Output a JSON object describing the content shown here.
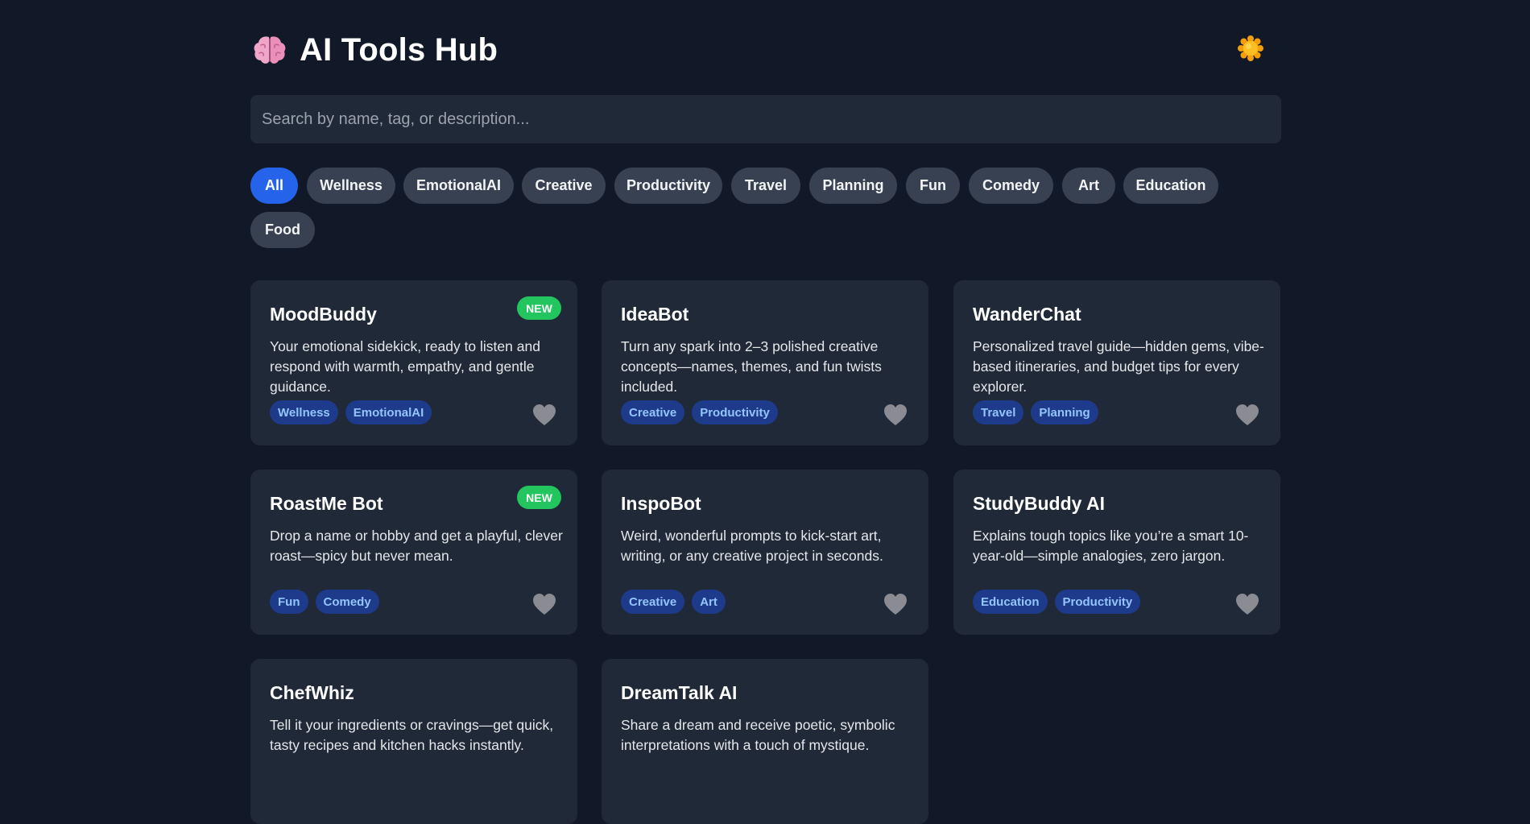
{
  "header": {
    "logo_icon": "brain-icon",
    "title": "AI Tools Hub",
    "theme_toggle_icon": "sun-icon"
  },
  "search": {
    "placeholder": "Search by name, tag, or description...",
    "value": ""
  },
  "filters": [
    {
      "label": "All",
      "active": true
    },
    {
      "label": "Wellness"
    },
    {
      "label": "EmotionalAI"
    },
    {
      "label": "Creative"
    },
    {
      "label": "Productivity"
    },
    {
      "label": "Travel"
    },
    {
      "label": "Planning"
    },
    {
      "label": "Fun"
    },
    {
      "label": "Comedy"
    },
    {
      "label": "Art"
    },
    {
      "label": "Education"
    },
    {
      "label": "Food"
    }
  ],
  "cards": [
    {
      "title": "MoodBuddy",
      "badge": "NEW",
      "description": "Your emotional sidekick, ready to listen and respond with warmth, empathy, and gentle guidance.",
      "tags": [
        "Wellness",
        "EmotionalAI"
      ]
    },
    {
      "title": "IdeaBot",
      "badge": "",
      "description": "Turn any spark into 2–3 polished creative concepts—names, themes, and fun twists included.",
      "tags": [
        "Creative",
        "Productivity"
      ]
    },
    {
      "title": "WanderChat",
      "badge": "",
      "description": "Personalized travel guide—hidden gems, vibe-based itineraries, and budget tips for every explorer.",
      "tags": [
        "Travel",
        "Planning"
      ]
    },
    {
      "title": "RoastMe Bot",
      "badge": "NEW",
      "description": "Drop a name or hobby and get a playful, clever roast—spicy but never mean.",
      "tags": [
        "Fun",
        "Comedy"
      ]
    },
    {
      "title": "InspoBot",
      "badge": "",
      "description": "Weird, wonderful prompts to kick-start art, writing, or any creative project in seconds.",
      "tags": [
        "Creative",
        "Art"
      ]
    },
    {
      "title": "StudyBuddy AI",
      "badge": "",
      "description": "Explains tough topics like you’re a smart 10-year-old—simple analogies, zero jargon.",
      "tags": [
        "Education",
        "Productivity"
      ]
    },
    {
      "title": "ChefWhiz",
      "badge": "",
      "description": "Tell it your ingredients or cravings—get quick, tasty recipes and kitchen hacks instantly.",
      "tags": []
    },
    {
      "title": "DreamTalk AI",
      "badge": "",
      "description": "Share a dream and receive poetic, symbolic interpretations with a touch of mystique.",
      "tags": []
    }
  ],
  "colors": {
    "background": "#111827",
    "card": "#1f2937",
    "accent": "#2563eb",
    "new_badge": "#22c55e",
    "tag_bg": "#1e3a8a",
    "tag_text": "#93c5fd"
  }
}
